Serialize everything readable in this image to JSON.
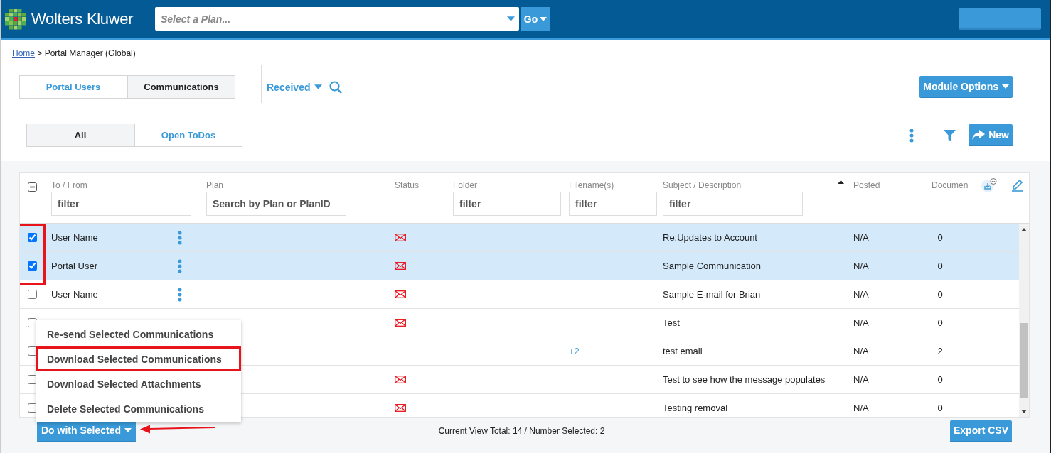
{
  "header": {
    "brand": "Wolters Kluwer",
    "plan_select": {
      "placeholder": "Select a Plan..."
    },
    "go_button": "Go"
  },
  "breadcrumb": {
    "home": "Home",
    "current": " > Portal Manager (Global)"
  },
  "module_tabs": [
    {
      "label": "Portal Users",
      "selected": false
    },
    {
      "label": "Communications",
      "selected": true
    }
  ],
  "view_dropdown": "Received",
  "module_options": "Module Options",
  "filter_tabs": [
    {
      "label": "All",
      "selected": true
    },
    {
      "label": "Open ToDos",
      "selected": false
    }
  ],
  "new_button": "New",
  "table": {
    "checkbox_column_highlighted": true,
    "select_all": {
      "indeterminate": true
    },
    "columns": [
      {
        "label": "To / From",
        "filter": {
          "placeholder": "filter"
        }
      },
      {
        "label": "Plan",
        "filter": {
          "placeholder": "Search by Plan or PlanID"
        }
      },
      {
        "label": "Status"
      },
      {
        "label": "Folder",
        "filter": {
          "placeholder": "filter"
        }
      },
      {
        "label": "Filename(s)",
        "filter": {
          "placeholder": "filter"
        }
      },
      {
        "label": "Subject / Description",
        "filter": {
          "placeholder": "filter"
        },
        "sorted": true
      },
      {
        "label": "Posted"
      },
      {
        "label": "Documen"
      }
    ],
    "rows": [
      {
        "selected": true,
        "to_from": "User Name",
        "mail_icon": true,
        "subject": "Re:Updates to Account",
        "posted": "N/A",
        "documents": "0"
      },
      {
        "selected": true,
        "to_from": "Portal User",
        "mail_icon": true,
        "subject": "Sample Communication",
        "posted": "N/A",
        "documents": "0"
      },
      {
        "selected": false,
        "to_from": "User Name",
        "mail_icon": true,
        "subject": "Sample E-mail for Brian",
        "posted": "N/A",
        "documents": "0"
      },
      {
        "selected": false,
        "mail_icon": true,
        "subject": "Test",
        "posted": "N/A",
        "documents": "0"
      },
      {
        "selected": false,
        "mail_icon": false,
        "filenames": "+2",
        "subject": "test email",
        "posted": "N/A",
        "documents": "2"
      },
      {
        "selected": false,
        "mail_icon": true,
        "subject": "Test to see how the message populates",
        "posted": "N/A",
        "documents": "0"
      },
      {
        "selected": false,
        "mail_icon": true,
        "subject": "Testing removal",
        "posted": "N/A",
        "documents": "0"
      }
    ]
  },
  "actions_menu": [
    {
      "label": "Re-send Selected Communications",
      "highlighted": false
    },
    {
      "label": "Download Selected Communications",
      "highlighted": true
    },
    {
      "label": "Download Selected Attachments",
      "highlighted": false
    },
    {
      "label": "Delete Selected Communications",
      "highlighted": false
    }
  ],
  "footer": {
    "do_with_selected": "Do with Selected",
    "pointer_arrow": true,
    "summary": "Current View Total: 14 / Number Selected: 2",
    "export_button": "Export CSV"
  }
}
